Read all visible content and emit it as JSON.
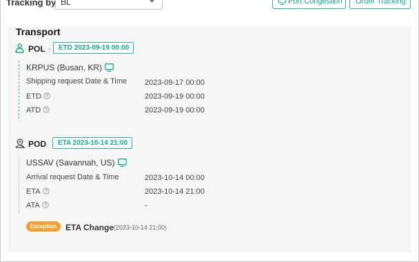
{
  "header": {
    "tracking_label": "Tracking by",
    "tracking_select_value": "BL",
    "port_congestion_label": "Port Congestion",
    "order_tracking_label": "Order Tracking"
  },
  "transport": {
    "title": "Transport",
    "pol": {
      "code": "POL",
      "tag": "ETD 2023-09-19 00:00",
      "location": "KRPUS (Busan, KR)",
      "rows": [
        {
          "label": "Shipping request Date & Time",
          "value": "2023-09-17 00:00"
        },
        {
          "label": "ETD",
          "value": "2023-09-19 00:00"
        },
        {
          "label": "ATD",
          "value": "2023-09-19 00:00"
        }
      ]
    },
    "pod": {
      "code": "POD",
      "tag": "ETA 2023-10-14 21:00",
      "location": "USSAV (Savannah, US)",
      "rows": [
        {
          "label": "Arrival request Date & Time",
          "value": "2023-10-14 00:00"
        },
        {
          "label": "ETA",
          "value": "2023-10-14 21:00"
        },
        {
          "label": "ATA",
          "value": "-"
        }
      ]
    },
    "exception": {
      "badge": "Exception",
      "title": "ETA Change",
      "date": "(2023-10-14 21:00)"
    }
  },
  "colors": {
    "accent": "#17a88d",
    "accent_border": "#2bb39a",
    "exception": "#f0a236",
    "panel_bg": "#f6f6f6"
  },
  "icons": {
    "pol": "anchor-person-icon",
    "pod": "map-pin-person-icon",
    "monitor": "monitor-icon",
    "help": "question-circle-icon",
    "dropdown": "chevron-down-icon"
  }
}
